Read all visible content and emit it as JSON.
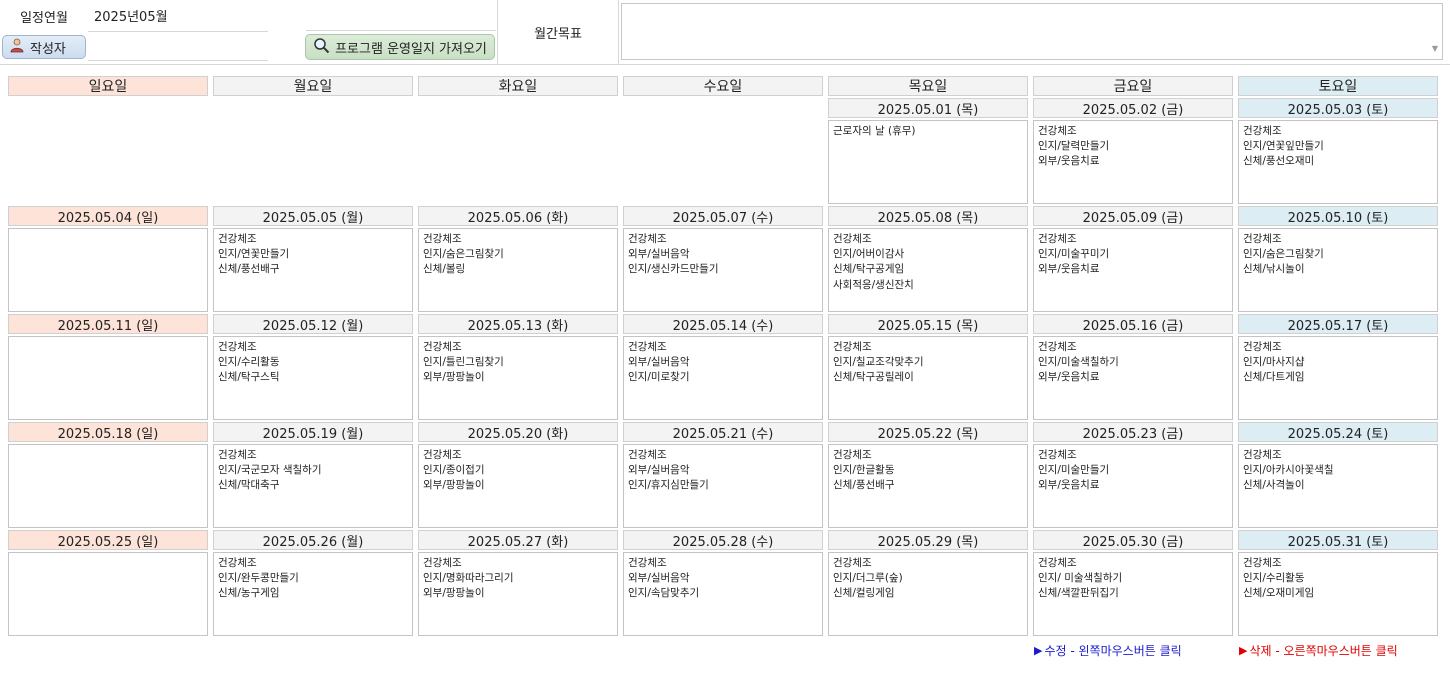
{
  "header": {
    "month_label": "일정연월",
    "month_value": "2025년05월",
    "author_button": "작성자",
    "author_value": "",
    "import_button": "프로그램 운영일지 가져오기",
    "goal_label": "월간목표",
    "goal_value": ""
  },
  "weekdays": [
    "일요일",
    "월요일",
    "화요일",
    "수요일",
    "목요일",
    "금요일",
    "토요일"
  ],
  "weeks": [
    [
      null,
      null,
      null,
      null,
      {
        "date": "2025.05.01 (목)",
        "items": [
          "근로자의 날 (휴무)"
        ]
      },
      {
        "date": "2025.05.02 (금)",
        "items": [
          "건강체조",
          "인지/달력만들기",
          "외부/웃음치료"
        ]
      },
      {
        "date": "2025.05.03 (토)",
        "items": [
          "건강체조",
          "인지/연꽃잎만들기",
          "신체/풍선오재미"
        ]
      }
    ],
    [
      {
        "date": "2025.05.04 (일)",
        "items": []
      },
      {
        "date": "2025.05.05 (월)",
        "items": [
          "건강체조",
          "인지/연꽃만들기",
          "신체/풍선배구"
        ]
      },
      {
        "date": "2025.05.06 (화)",
        "items": [
          "건강체조",
          "인지/숨은그림찾기",
          "신체/볼링"
        ]
      },
      {
        "date": "2025.05.07 (수)",
        "items": [
          "건강체조",
          "외부/실버음악",
          "인지/생신카드만들기"
        ]
      },
      {
        "date": "2025.05.08 (목)",
        "items": [
          "건강체조",
          "인지/어버이감사",
          "신체/탁구공게임",
          "사회적응/생신잔치"
        ]
      },
      {
        "date": "2025.05.09 (금)",
        "items": [
          "건강체조",
          "인지/미술꾸미기",
          "외부/웃음치료"
        ]
      },
      {
        "date": "2025.05.10 (토)",
        "items": [
          "건강체조",
          "인지/숨은그림찾기",
          "신체/낚시놀이"
        ]
      }
    ],
    [
      {
        "date": "2025.05.11 (일)",
        "items": []
      },
      {
        "date": "2025.05.12 (월)",
        "items": [
          "건강체조",
          "인지/수리활동",
          "신체/탁구스틱"
        ]
      },
      {
        "date": "2025.05.13 (화)",
        "items": [
          "건강체조",
          "인지/틀린그림찾기",
          "외부/팡팡놀이"
        ]
      },
      {
        "date": "2025.05.14 (수)",
        "items": [
          "건강체조",
          "외부/실버음악",
          "인지/미로찾기"
        ]
      },
      {
        "date": "2025.05.15 (목)",
        "items": [
          "건강체조",
          "인지/칠교조각맞추기",
          "신체/탁구공릴레이"
        ]
      },
      {
        "date": "2025.05.16 (금)",
        "items": [
          "건강체조",
          "인지/미술색칠하기",
          "외부/웃음치료"
        ]
      },
      {
        "date": "2025.05.17 (토)",
        "items": [
          "건강체조",
          "인지/마사지샵",
          "신체/다트게임"
        ]
      }
    ],
    [
      {
        "date": "2025.05.18 (일)",
        "items": []
      },
      {
        "date": "2025.05.19 (월)",
        "items": [
          "건강체조",
          "인지/국군모자 색칠하기",
          "신체/막대축구"
        ]
      },
      {
        "date": "2025.05.20 (화)",
        "items": [
          "건강체조",
          "인지/종이접기",
          "외부/팡팡놀이"
        ]
      },
      {
        "date": "2025.05.21 (수)",
        "items": [
          "건강체조",
          "외부/실버음악",
          "인지/휴지심만들기"
        ]
      },
      {
        "date": "2025.05.22 (목)",
        "items": [
          "건강체조",
          "인지/한글활동",
          "신체/풍선배구"
        ]
      },
      {
        "date": "2025.05.23 (금)",
        "items": [
          "건강체조",
          "인지/미술만들기",
          "외부/웃음치료"
        ]
      },
      {
        "date": "2025.05.24 (토)",
        "items": [
          "건강체조",
          "인지/아카시아꽃색칠",
          "신체/사격놀이"
        ]
      }
    ],
    [
      {
        "date": "2025.05.25 (일)",
        "items": []
      },
      {
        "date": "2025.05.26 (월)",
        "items": [
          "건강체조",
          "인지/완두콩만들기",
          "신체/농구게임"
        ]
      },
      {
        "date": "2025.05.27 (화)",
        "items": [
          "건강체조",
          "인지/명화따라그리기",
          "외부/팡팡놀이"
        ]
      },
      {
        "date": "2025.05.28 (수)",
        "items": [
          "건강체조",
          "외부/실버음악",
          "인지/속담맞추기"
        ]
      },
      {
        "date": "2025.05.29 (목)",
        "items": [
          "건강체조",
          "인지/더그루(숲)",
          "신체/컬링게임"
        ]
      },
      {
        "date": "2025.05.30 (금)",
        "items": [
          "건강체조",
          "인지/ 미술색칠하기",
          "신체/색깔판뒤집기"
        ]
      },
      {
        "date": "2025.05.31 (토)",
        "items": [
          "건강체조",
          "인지/수리활동",
          "신체/오재미게임"
        ]
      }
    ]
  ],
  "legend": {
    "edit_text": "수정 - 왼쪽마우스버튼 클릭",
    "delete_text": "삭제 - 오른쪽마우스버튼 클릭",
    "edit_color": "#1a1acc",
    "delete_color": "#e00000"
  },
  "colors": {
    "sunday_bg": "#fde3d8",
    "saturday_bg": "#dcedf3",
    "weekday_bg": "#f3f3f3",
    "button_green": "#c8e0c4",
    "button_blue": "#cddcee"
  },
  "icons": {
    "author": "person-icon",
    "import": "search-icon",
    "triangle": "▶"
  }
}
